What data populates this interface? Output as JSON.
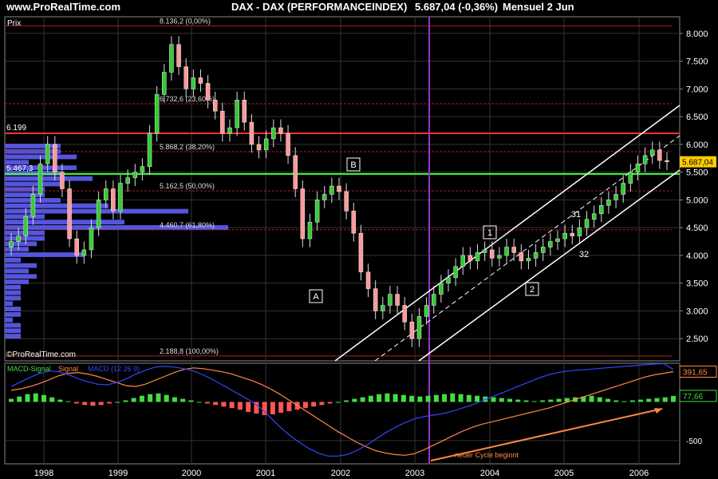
{
  "header": {
    "site": "www.ProRealTime.com",
    "title": "DAX - DAX (PERFORMANCEINDEX)",
    "last": "5.687,04 (-0,36%)",
    "period": "Mensuel  2 Jun"
  },
  "watermark": "©ProRealTime.com",
  "price_panel_label": "Prix",
  "macd_legend": {
    "macd_signal": "MACD-Signal",
    "signal": "Signal",
    "macd": "MACD (12 26 9)"
  },
  "annotation": "neuer Cycle beginnt",
  "colors": {
    "up": "#ff9999",
    "down": "#33cc33",
    "volume_profile": "#5555dd",
    "fib_line": "#aa2222",
    "resistance": "#ff3333",
    "support": "#44ff44",
    "channel": "#ffffff",
    "vertical_marker": "#9933cc",
    "macd_line": "#3344ff",
    "signal_line": "#ff8844",
    "hist_pos": "#44dd44",
    "hist_neg": "#ff5555",
    "arrow": "#ff8844"
  },
  "chart_data": [
    {
      "type": "candlestick",
      "title": "DAX - DAX (PERFORMANCEINDEX)",
      "x_ticks": [
        "1998",
        "1999",
        "2000",
        "2001",
        "2002",
        "2003",
        "2004",
        "2005",
        "2006"
      ],
      "y_ticks": [
        "8.000",
        "7.500",
        "7.000",
        "6.500",
        "6.000",
        "5.500",
        "5.000",
        "4.500",
        "4.000",
        "3.500",
        "3.000",
        "2.500"
      ],
      "ylim": [
        2100,
        8300
      ],
      "series": [
        {
          "values_close": [
            4250,
            4350,
            4700,
            5100,
            5650,
            6000,
            5500,
            5200,
            4300,
            4000,
            4100,
            4500,
            5000,
            5200,
            4800,
            5300,
            5400,
            5500,
            5600,
            6200,
            6900,
            7300,
            7800,
            7400,
            7000,
            7200,
            7100,
            6800,
            6600,
            6200,
            6300,
            6800,
            6400,
            6000,
            5900,
            6100,
            6300,
            6200,
            5800,
            5200,
            4300,
            4600,
            5000,
            5100,
            5250,
            5150,
            4800,
            4400,
            3700,
            3400,
            3000,
            3100,
            3300,
            3100,
            2800,
            2500,
            2900,
            3100,
            3300,
            3500,
            3600,
            3800,
            4000,
            3900,
            4050,
            4100,
            3950,
            4000,
            4150,
            4050,
            3900,
            3950,
            4050,
            4150,
            4250,
            4300,
            4400,
            4350,
            4500,
            4650,
            4750,
            4900,
            5000,
            5100,
            5300,
            5500,
            5650,
            5800,
            5900,
            5710,
            5687
          ]
        }
      ],
      "annotations": [
        {
          "label": "8.136,2 (0,00%)",
          "value": 8136.2
        },
        {
          "label": "6.732,6 (23,60%)",
          "value": 6732.6
        },
        {
          "label": "5.868,2 (38,20%)",
          "value": 5868.2
        },
        {
          "label": "5.162,5 (50,00%)",
          "value": 5162.5
        },
        {
          "label": "4.460,7 (61,80%)",
          "value": 4460.7
        },
        {
          "label": "2.188,8 (100,00%)",
          "value": 2188.8
        },
        {
          "label": "6.199",
          "value": 6199
        },
        {
          "label": "5.467,3",
          "value": 5467.3
        },
        {
          "label": "5.687,04",
          "value": 5687.04
        }
      ],
      "wave_labels": [
        "A",
        "B",
        "1",
        "2",
        "31",
        "32"
      ],
      "volume_profile": [
        0.07,
        0.07,
        0.09,
        0.03,
        0.09,
        0.07,
        0.11,
        0.07,
        0.05,
        0.05,
        0.07,
        0.13,
        0.23,
        0.05,
        0.15,
        0.28,
        0.05,
        0.05,
        0.04,
        0.03,
        0.1,
        0.02,
        0.04,
        0.03,
        0.04,
        0.03,
        0.02,
        0.02,
        0.02,
        0.01,
        0.02,
        0.02,
        0.01,
        0.02,
        0.02,
        0.02
      ],
      "grid": true
    },
    {
      "type": "line",
      "title": "MACD-Signal Signal MACD (12 26 9)",
      "y_ticks": [
        "-500"
      ],
      "ylim": [
        -800,
        500
      ],
      "series": [
        {
          "name": "MACD-Signal",
          "values": [
            40,
            70,
            100,
            110,
            90,
            60,
            30,
            10,
            -20,
            -40,
            -50,
            -40,
            -20,
            0,
            20,
            50,
            80,
            100,
            110,
            90,
            60,
            40,
            20,
            0,
            -20,
            -40,
            -60,
            -80,
            -100,
            -130,
            -150,
            -170,
            -160,
            -140,
            -120,
            -100,
            -80,
            -60,
            -40,
            -20,
            0,
            20,
            40,
            60,
            80,
            100,
            110,
            100,
            90,
            80,
            70,
            80,
            90,
            100,
            110,
            100,
            90,
            80,
            70,
            60,
            50,
            40,
            30,
            20,
            10,
            20,
            30,
            40,
            50,
            60,
            70,
            80,
            60,
            40,
            20,
            10,
            20,
            30,
            40,
            50,
            60,
            77.66
          ]
        },
        {
          "name": "Signal",
          "values": [
            150,
            170,
            200,
            240,
            290,
            340,
            370,
            380,
            360,
            330,
            290,
            250,
            210,
            200,
            230,
            280,
            330,
            380,
            420,
            440,
            430,
            410,
            390,
            360,
            320,
            280,
            230,
            170,
            100,
            20,
            -60,
            -140,
            -220,
            -300,
            -380,
            -450,
            -520,
            -580,
            -630,
            -660,
            -680,
            -690,
            -670,
            -620,
            -560,
            -500,
            -440,
            -380,
            -330,
            -290,
            -260,
            -230,
            -200,
            -170,
            -140,
            -110,
            -80,
            -40,
            0,
            40,
            80,
            120,
            160,
            200,
            240,
            280,
            320,
            350,
            370,
            391.65
          ]
        },
        {
          "name": "MACD (12 26 9)",
          "values": [
            200,
            260,
            320,
            370,
            400,
            390,
            350,
            300,
            260,
            230,
            220,
            250,
            300,
            360,
            410,
            450,
            460,
            450,
            430,
            400,
            350,
            290,
            220,
            150,
            80,
            10,
            -80,
            -200,
            -320,
            -430,
            -520,
            -600,
            -660,
            -700,
            -700,
            -680,
            -630,
            -560,
            -480,
            -400,
            -330,
            -270,
            -220,
            -190,
            -170,
            -150,
            -120,
            -80,
            -40,
            10,
            60,
            110,
            160,
            210,
            260,
            310,
            350,
            380,
            400,
            410,
            420,
            430,
            440,
            450,
            460,
            470,
            480,
            490,
            495,
            420
          ]
        }
      ],
      "right_labels": [
        "391,65",
        "77,66"
      ],
      "grid": true
    }
  ]
}
